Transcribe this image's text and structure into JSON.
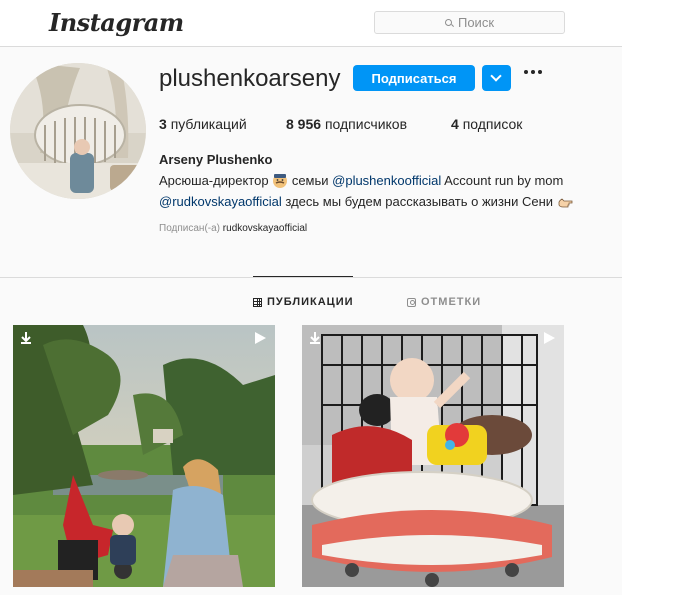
{
  "header": {
    "logo": "Instagram",
    "search_placeholder": "Поиск"
  },
  "profile": {
    "username": "plushenkoarseny",
    "follow_label": "Подписаться",
    "stats": [
      {
        "value": "3",
        "label": "публикаций"
      },
      {
        "value": "8 956",
        "label": "подписчиков"
      },
      {
        "value": "4",
        "label": "подписок"
      }
    ],
    "full_name": "Arseny Plushenko",
    "bio_line1_a": "Арсюша-директор",
    "bio_line1_b": "семьи",
    "bio_mention1": "@plushenkoofficial",
    "bio_line1_c": "Account run by mom",
    "bio_mention2": "@rudkovskayaofficial",
    "bio_line2_b": "здесь мы будем рассказывать о жизни Сени",
    "followed_by_label": "Подписан(-а)",
    "followed_by_name": "rudkovskayaofficial"
  },
  "tabs": [
    {
      "label": "ПУБЛИКАЦИИ",
      "icon": "grid-icon",
      "active": true
    },
    {
      "label": "ОТМЕТКИ",
      "icon": "tag-icon",
      "active": false
    }
  ],
  "posts": [
    {
      "icon_left": "igtv-icon",
      "icon_right": "video-icon"
    },
    {
      "icon_left": "igtv-icon",
      "icon_right": "video-icon"
    }
  ],
  "colors": {
    "accent": "#0095f6",
    "mention": "#00376b",
    "muted": "#8e8e8e"
  }
}
